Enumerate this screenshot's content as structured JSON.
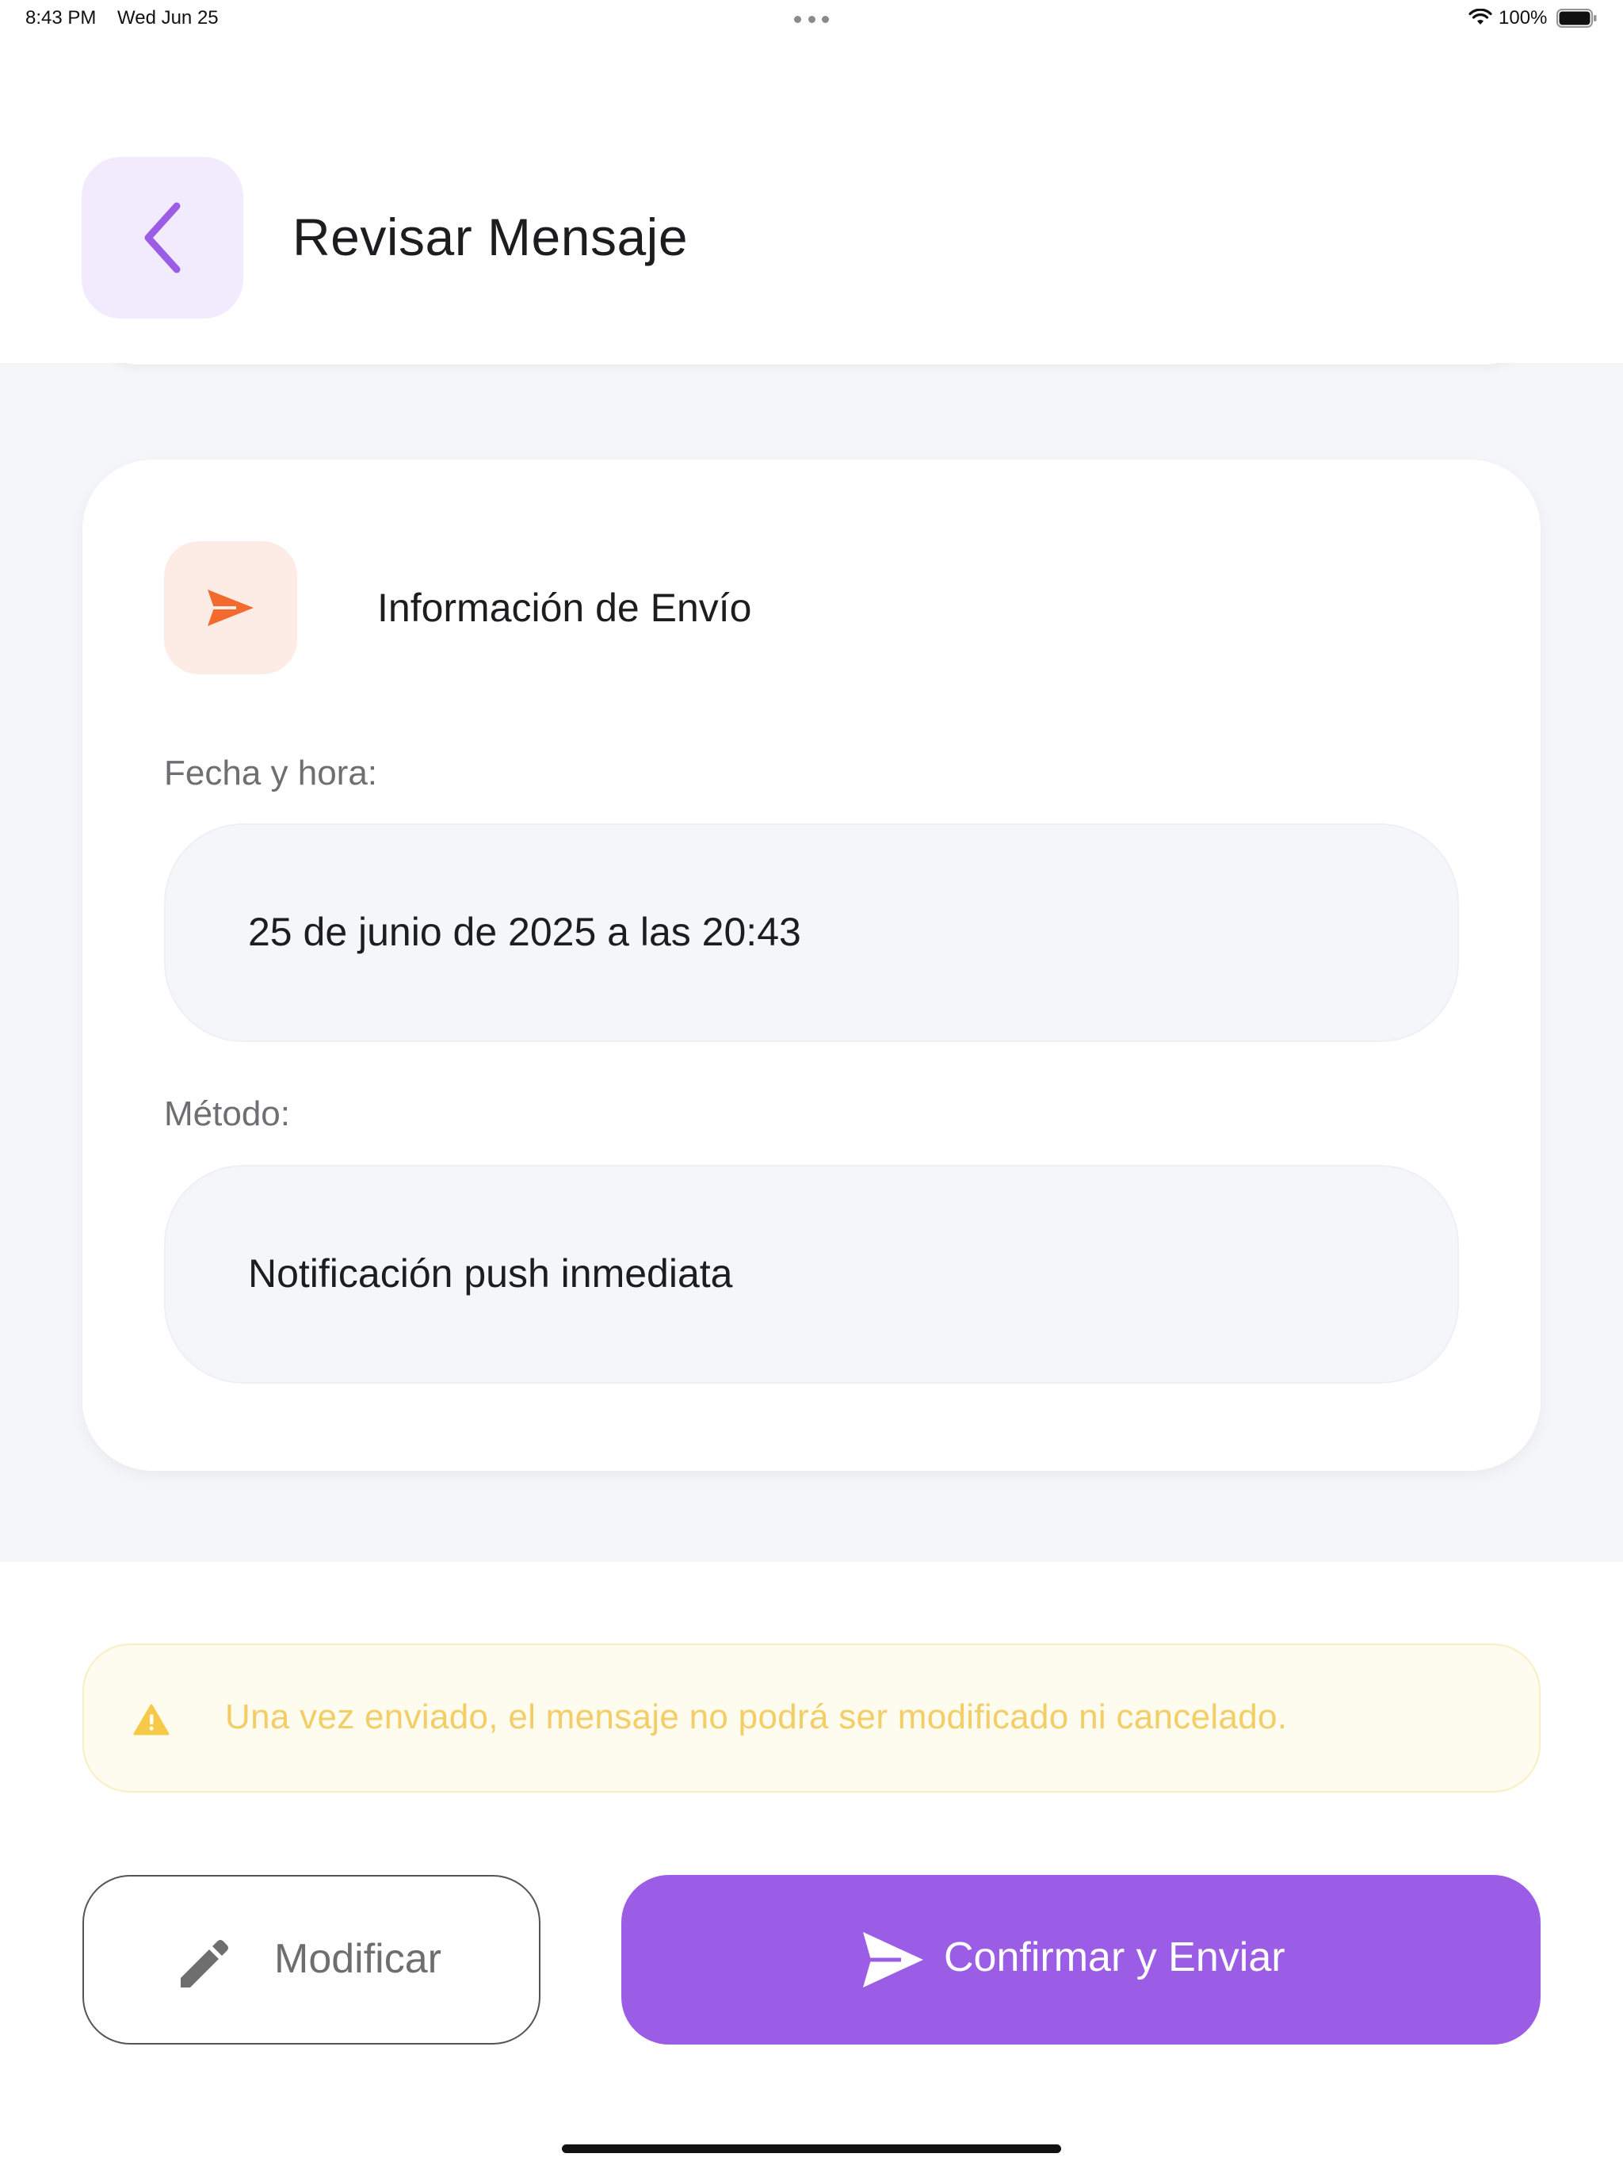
{
  "status_bar": {
    "time": "8:43 PM",
    "date": "Wed Jun 25",
    "battery": "100%"
  },
  "header": {
    "title": "Revisar Mensaje",
    "back_icon": "chevron-left-icon"
  },
  "shipping_card": {
    "title": "Información de Envío",
    "icon": "send-icon",
    "date_label": "Fecha y hora:",
    "date_value": "25 de junio de 2025 a las 20:43",
    "method_label": "Método:",
    "method_value": "Notificación push inmediata"
  },
  "warning": {
    "icon": "warning-icon",
    "text": "Una vez enviado, el mensaje no podrá ser modificado ni cancelado."
  },
  "actions": {
    "modify_label": "Modificar",
    "confirm_label": "Confirmar y Enviar"
  },
  "colors": {
    "accent": "#9b5de5",
    "accent_light": "#f1ebfd",
    "send_orange": "#f26a2e",
    "send_orange_light": "#fdece5",
    "warning_yellow": "#f3cd66",
    "warning_bg": "#fefbef",
    "background_grey": "#f5f6f9"
  }
}
